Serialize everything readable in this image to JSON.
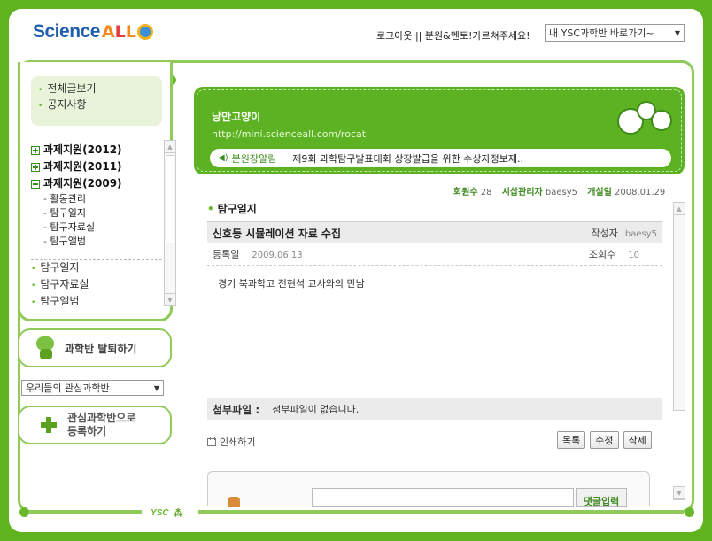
{
  "header": {
    "logo": "Science All",
    "logout": "로그아웃",
    "divider": " || ",
    "mentor": "분원&멘토!가르쳐주세요!",
    "ysc_select": "내 YSC과학반 바로가기~"
  },
  "sidebar": {
    "top_items": [
      {
        "label": "전체글보기"
      },
      {
        "label": "공지사항"
      }
    ],
    "folders": [
      {
        "label": "과제지원(2012)"
      },
      {
        "label": "과제지원(2011)"
      },
      {
        "label": "과제지원(2009)"
      }
    ],
    "subitems": [
      {
        "label": "활동관리"
      },
      {
        "label": "탐구일지"
      },
      {
        "label": "탐구자료실"
      },
      {
        "label": "탐구앨범"
      }
    ],
    "items": [
      {
        "label": "탐구일지"
      },
      {
        "label": "탐구자료실"
      },
      {
        "label": "탐구앨범"
      }
    ],
    "leave_button": "과학반 탈퇴하기",
    "interest_select": "우리들의 관심과학반",
    "register_button_line1": "관심과학반으로",
    "register_button_line2": "등록하기"
  },
  "banner": {
    "name": "낭만고양이",
    "url": "http://mini.scienceall.com/rocat",
    "notice_tag": "분원장알림",
    "notice_msg": "제9회 과학탐구발표대회 상장발급을 위한 수상자정보재.."
  },
  "meta": {
    "members_label": "회원수",
    "members_value": "28",
    "admin_label": "시삽관리자",
    "admin_value": "baesy5",
    "opened_label": "개설일",
    "opened_value": "2008.01.29"
  },
  "section_title": "탐구일지",
  "post": {
    "title": "신호등 시뮬레이션 자료 수집",
    "author_label": "작성자",
    "author_value": "baesy5",
    "date_label": "등록일",
    "date_value": "2009.06.13",
    "views_label": "조회수",
    "views_value": "10",
    "body": "경기 북과학고 전현석 교사와의 만남",
    "attach_label": "첨부파일 :",
    "attach_value": "첨부파일이 없습니다."
  },
  "print_label": "인쇄하기",
  "actions": {
    "list": "목록",
    "edit": "수정",
    "delete": "삭제"
  },
  "comment": {
    "submit": "댓글입력"
  },
  "footer": {
    "ysc": "YSC"
  },
  "colors": {
    "brand_green": "#5fb31f",
    "light_green": "#8fca5a",
    "accent_orange": "#f08a1c",
    "logo_blue": "#1f5fae"
  }
}
